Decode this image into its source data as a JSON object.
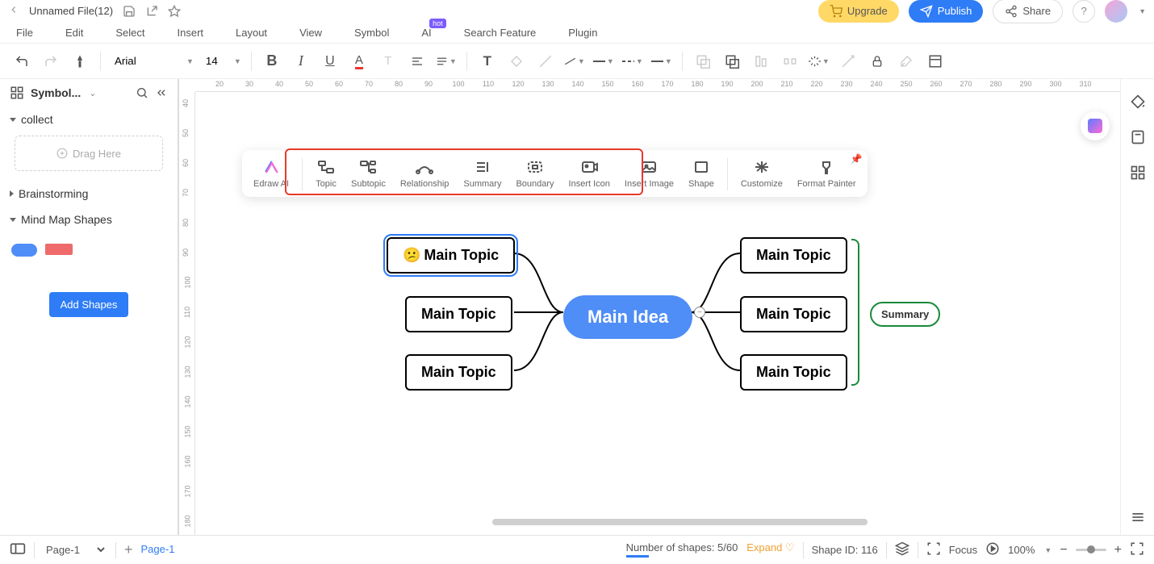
{
  "topbar": {
    "filename": "Unnamed File(12)",
    "upgrade": "Upgrade",
    "publish": "Publish",
    "share": "Share"
  },
  "menu": {
    "file": "File",
    "edit": "Edit",
    "select": "Select",
    "insert": "Insert",
    "layout": "Layout",
    "view": "View",
    "symbol": "Symbol",
    "ai": "AI",
    "hot": "hot",
    "search": "Search Feature",
    "plugin": "Plugin"
  },
  "toolbar": {
    "font": "Arial",
    "size": "14"
  },
  "left": {
    "title": "Symbol...",
    "collect": "collect",
    "drag": "Drag Here",
    "brain": "Brainstorming",
    "mms": "Mind Map Shapes",
    "add": "Add Shapes"
  },
  "float": {
    "ai": "Edraw AI",
    "topic": "Topic",
    "subtopic": "Subtopic",
    "rel": "Relationship",
    "summary": "Summary",
    "boundary": "Boundary",
    "icon": "Insert Icon",
    "image": "Insert Image",
    "shape": "Shape",
    "customize": "Customize",
    "painter": "Format Painter"
  },
  "nodes": {
    "idea": "Main Idea",
    "l1": "Main Topic",
    "l2": "Main Topic",
    "l3": "Main Topic",
    "r1": "Main Topic",
    "r2": "Main Topic",
    "r3": "Main Topic",
    "summary": "Summary",
    "emoji": "😕"
  },
  "ruler_h": [
    "20",
    "30",
    "40",
    "50",
    "60",
    "70",
    "80",
    "90",
    "100",
    "110",
    "120",
    "130",
    "140",
    "150",
    "160",
    "170",
    "180",
    "190",
    "200",
    "210",
    "220",
    "230",
    "240",
    "250",
    "260",
    "270",
    "280",
    "290",
    "300",
    "310"
  ],
  "ruler_v": [
    "40",
    "50",
    "60",
    "70",
    "80",
    "90",
    "100",
    "110",
    "120",
    "130",
    "140",
    "150",
    "160",
    "170",
    "180"
  ],
  "status": {
    "page_sel": "Page-1",
    "page_tab": "Page-1",
    "shapes_lbl": "Number of shapes: 5/60",
    "expand": "Expand",
    "shape_id": "Shape ID: 116",
    "focus": "Focus",
    "zoom": "100%"
  }
}
